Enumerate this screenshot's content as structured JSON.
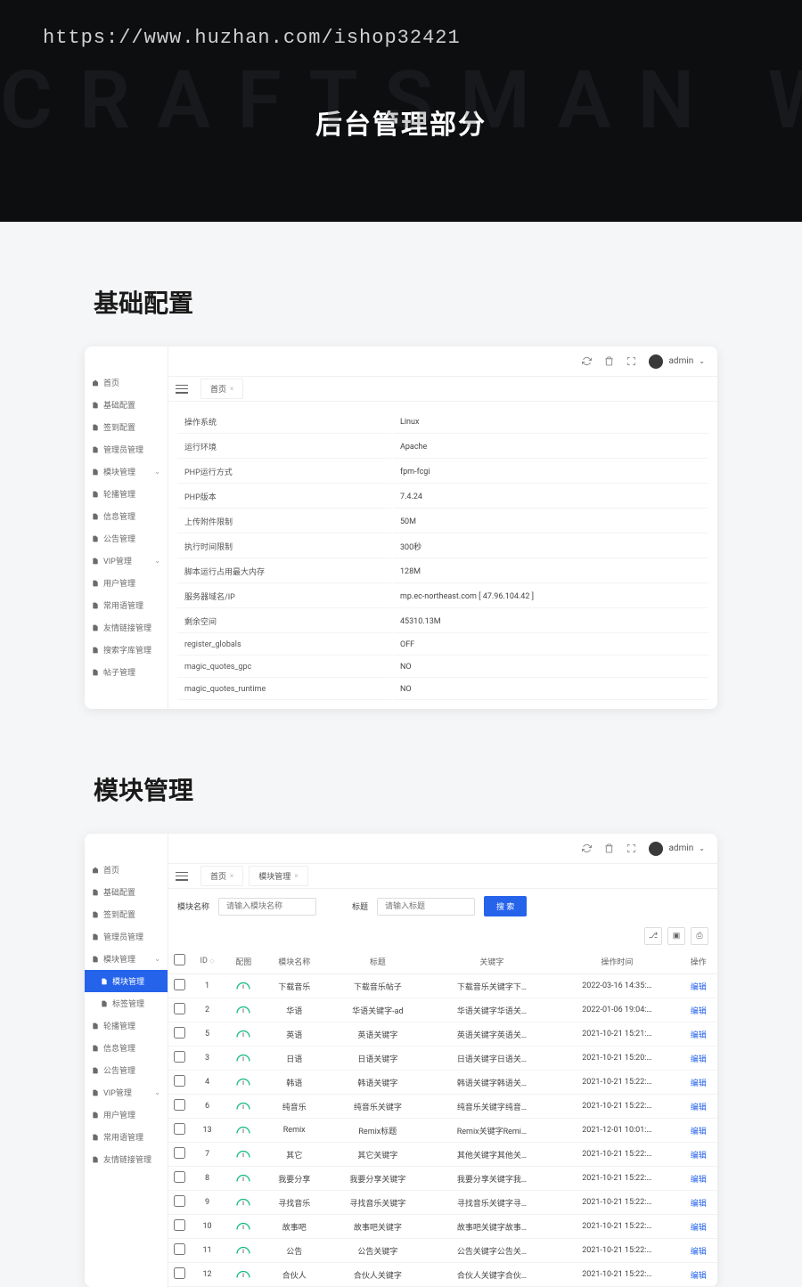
{
  "hero": {
    "url": "https://www.huzhan.com/ishop32421",
    "bg": "CRAFTSMAN WEB",
    "title": "后台管理部分"
  },
  "section1_title": "基础配置",
  "section2_title": "模块管理",
  "topbar": {
    "user": "admin"
  },
  "sidebar1": [
    "首页",
    "基础配置",
    "签到配置",
    "管理员管理",
    "模块管理",
    "轮播管理",
    "信息管理",
    "公告管理",
    "VIP管理",
    "用户管理",
    "常用语管理",
    "友情链接管理",
    "搜索字库管理",
    "帖子管理"
  ],
  "tabs1": [
    "首页"
  ],
  "info_rows": [
    [
      "操作系统",
      "Linux"
    ],
    [
      "运行环境",
      "Apache"
    ],
    [
      "PHP运行方式",
      "fpm-fcgi"
    ],
    [
      "PHP版本",
      "7.4.24"
    ],
    [
      "上传附件限制",
      "50M"
    ],
    [
      "执行时间限制",
      "300秒"
    ],
    [
      "脚本运行占用最大内存",
      "128M"
    ],
    [
      "服务器域名/IP",
      "mp.ec-northeast.com [ 47.96.104.42 ]"
    ],
    [
      "剩余空间",
      "45310.13M"
    ],
    [
      "register_globals",
      "OFF"
    ],
    [
      "magic_quotes_gpc",
      "NO"
    ],
    [
      "magic_quotes_runtime",
      "NO"
    ]
  ],
  "sidebar2": [
    "首页",
    "基础配置",
    "签到配置",
    "管理员管理",
    "模块管理",
    "模块管理",
    "标签管理",
    "轮播管理",
    "信息管理",
    "公告管理",
    "VIP管理",
    "用户管理",
    "常用语管理",
    "友情链接管理"
  ],
  "tabs2": [
    "首页",
    "模块管理"
  ],
  "filter": {
    "name_label": "模块名称",
    "name_ph": "请输入模块名称",
    "title_label": "标题",
    "title_ph": "请输入标题",
    "search": "搜 索"
  },
  "columns": [
    "ID",
    "配图",
    "模块名称",
    "标题",
    "关键字",
    "操作时间",
    "操作"
  ],
  "edit_label": "编辑",
  "rows": [
    {
      "id": "1",
      "name": "下载音乐",
      "title": "下载音乐帖子",
      "keyword": "下载音乐关键字下…",
      "time": "2022-03-16 14:35:…"
    },
    {
      "id": "2",
      "name": "华语",
      "title": "华语关键字-ad",
      "keyword": "华语关键字华语关…",
      "time": "2022-01-06 19:04:…"
    },
    {
      "id": "5",
      "name": "英语",
      "title": "英语关键字",
      "keyword": "英语关键字英语关…",
      "time": "2021-10-21 15:21:…"
    },
    {
      "id": "3",
      "name": "日语",
      "title": "日语关键字",
      "keyword": "日语关键字日语关…",
      "time": "2021-10-21 15:20:…"
    },
    {
      "id": "4",
      "name": "韩语",
      "title": "韩语关键字",
      "keyword": "韩语关键字韩语关…",
      "time": "2021-10-21 15:22:…"
    },
    {
      "id": "6",
      "name": "纯音乐",
      "title": "纯音乐关键字",
      "keyword": "纯音乐关键字纯音…",
      "time": "2021-10-21 15:22:…"
    },
    {
      "id": "13",
      "name": "Remix",
      "title": "Remix标题",
      "keyword": "Remix关键字Remi…",
      "time": "2021-12-01 10:01:…"
    },
    {
      "id": "7",
      "name": "其它",
      "title": "其它关键字",
      "keyword": "其他关键字其他关…",
      "time": "2021-10-21 15:22:…"
    },
    {
      "id": "8",
      "name": "我要分享",
      "title": "我要分享关键字",
      "keyword": "我要分享关键字我…",
      "time": "2021-10-21 15:22:…"
    },
    {
      "id": "9",
      "name": "寻找音乐",
      "title": "寻找音乐关键字",
      "keyword": "寻找音乐关键字寻…",
      "time": "2021-10-21 15:22:…"
    },
    {
      "id": "10",
      "name": "故事吧",
      "title": "故事吧关键字",
      "keyword": "故事吧关键字故事…",
      "time": "2021-10-21 15:22:…"
    },
    {
      "id": "11",
      "name": "公告",
      "title": "公告关键字",
      "keyword": "公告关键字公告关…",
      "time": "2021-10-21 15:22:…"
    },
    {
      "id": "12",
      "name": "合伙人",
      "title": "合伙人关键字",
      "keyword": "合伙人关键字合伙…",
      "time": "2021-10-21 15:22:…"
    }
  ]
}
